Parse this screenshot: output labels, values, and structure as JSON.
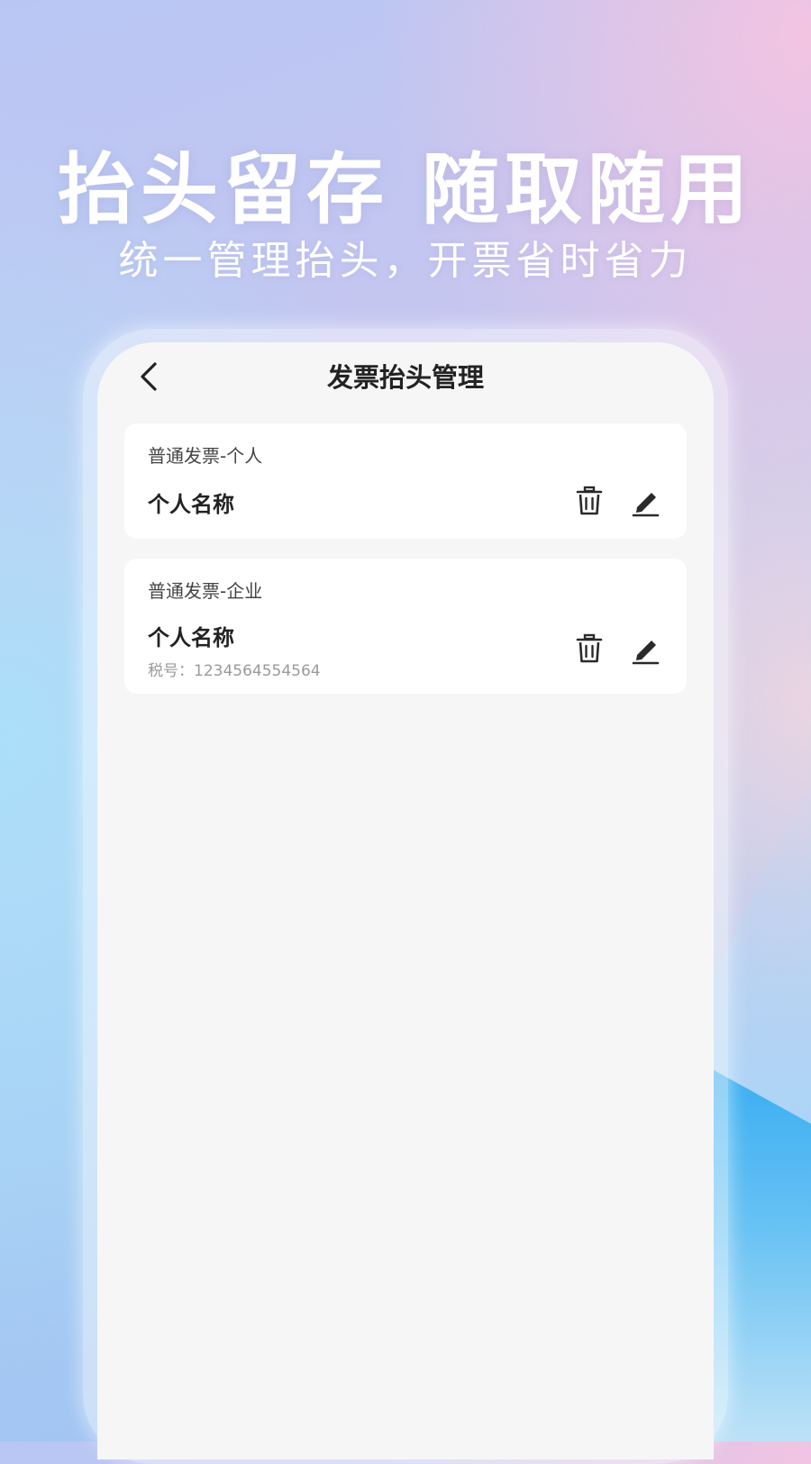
{
  "promo": {
    "headline": "抬头留存 随取随用",
    "subline": "统一管理抬头，开票省时省力"
  },
  "nav": {
    "title": "发票抬头管理",
    "back_icon": "chevron-left-icon"
  },
  "invoice_titles": [
    {
      "type": "普通发票-个人",
      "name": "个人名称",
      "delete_icon": "trash-icon",
      "edit_icon": "pencil-icon"
    },
    {
      "type": "普通发票-企业",
      "name": "个人名称",
      "tax_id": "税号：1234564554564",
      "delete_icon": "trash-icon",
      "edit_icon": "pencil-icon"
    }
  ],
  "colors": {
    "screen_bg": "#f6f6f6",
    "card_bg": "#ffffff",
    "primary_text": "#222222",
    "secondary_text": "#9a9a9a"
  }
}
